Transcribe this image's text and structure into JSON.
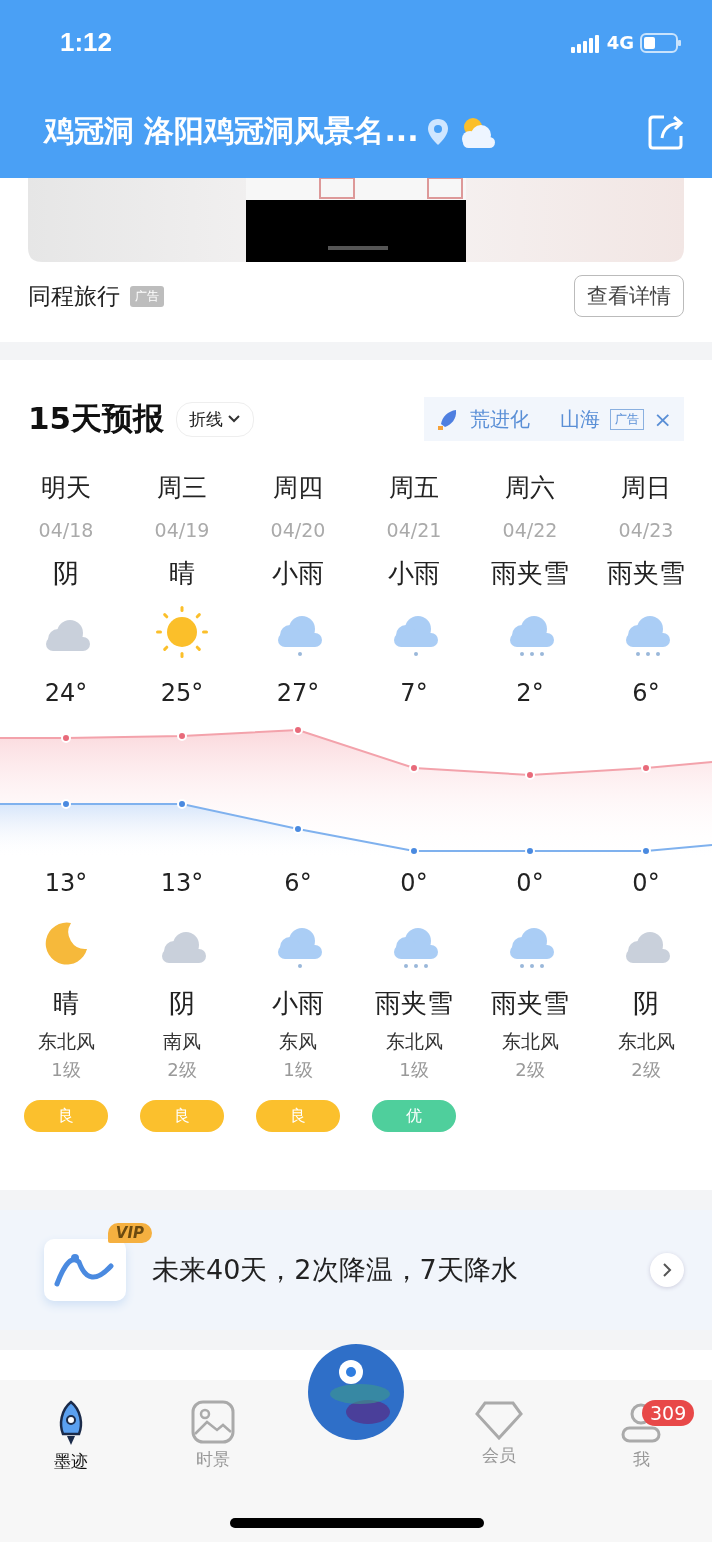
{
  "status_bar": {
    "time": "1:12",
    "network": "4G"
  },
  "header": {
    "title": "鸡冠洞 洛阳鸡冠洞风景名..."
  },
  "ad_card": {
    "advertiser": "同程旅行",
    "ad_tag": "广告",
    "button": "查看详情"
  },
  "forecast": {
    "title": "15天预报",
    "mode": "折线",
    "ad": {
      "name": "荒进化",
      "subtitle": "山海",
      "tag": "广告",
      "close": "×"
    },
    "days": [
      {
        "label": "明天",
        "date": "04/18",
        "day": {
          "weather": "阴",
          "kind": "cloudy"
        },
        "high": "24°",
        "low": "13°",
        "night": {
          "weather": "晴",
          "kind": "moon"
        },
        "wind": "东北风",
        "wind_level": "1级",
        "aqi": {
          "text": "良",
          "color": "#fbc02d"
        }
      },
      {
        "label": "周三",
        "date": "04/19",
        "day": {
          "weather": "晴",
          "kind": "sunny"
        },
        "high": "25°",
        "low": "13°",
        "night": {
          "weather": "阴",
          "kind": "cloudy"
        },
        "wind": "南风",
        "wind_level": "2级",
        "aqi": {
          "text": "良",
          "color": "#fbc02d"
        }
      },
      {
        "label": "周四",
        "date": "04/20",
        "day": {
          "weather": "小雨",
          "kind": "rain"
        },
        "high": "27°",
        "low": "6°",
        "night": {
          "weather": "小雨",
          "kind": "rain"
        },
        "wind": "东风",
        "wind_level": "1级",
        "aqi": {
          "text": "良",
          "color": "#fbc02d"
        }
      },
      {
        "label": "周五",
        "date": "04/21",
        "day": {
          "weather": "小雨",
          "kind": "rain"
        },
        "high": "7°",
        "low": "0°",
        "night": {
          "weather": "雨夹雪",
          "kind": "sleet"
        },
        "wind": "东北风",
        "wind_level": "1级",
        "aqi": {
          "text": "优",
          "color": "#4fcf9c"
        }
      },
      {
        "label": "周六",
        "date": "04/22",
        "day": {
          "weather": "雨夹雪",
          "kind": "sleet"
        },
        "high": "2°",
        "low": "0°",
        "night": {
          "weather": "雨夹雪",
          "kind": "sleet"
        },
        "wind": "东北风",
        "wind_level": "2级"
      },
      {
        "label": "周日",
        "date": "04/23",
        "day": {
          "weather": "雨夹雪",
          "kind": "sleet"
        },
        "high": "6°",
        "low": "0°",
        "night": {
          "weather": "阴",
          "kind": "cloudy"
        },
        "wind": "东北风",
        "wind_level": "2级"
      }
    ]
  },
  "vip_banner": {
    "badge": "VIP",
    "text": "未来40天，2次降温，7天降水"
  },
  "nav": {
    "tabs": [
      {
        "label": "墨迹",
        "selected": true
      },
      {
        "label": "时景",
        "selected": false
      },
      {
        "label": "会员",
        "selected": false
      },
      {
        "label": "我",
        "selected": false,
        "badge": "309"
      }
    ]
  }
}
